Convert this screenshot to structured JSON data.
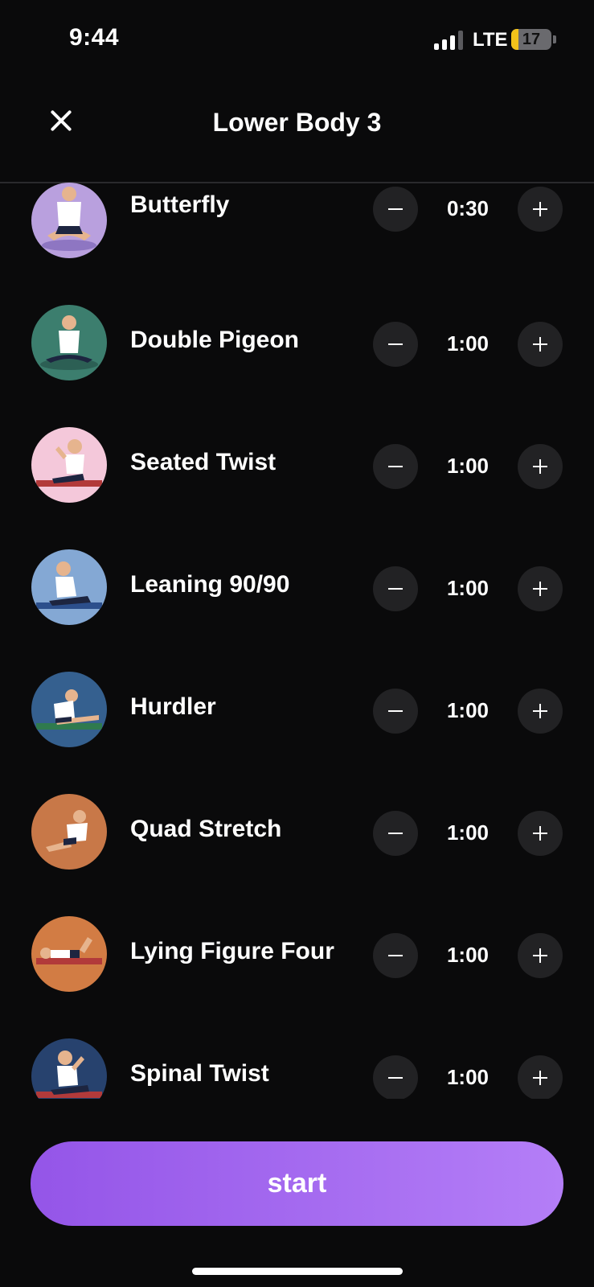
{
  "status_bar": {
    "time": "9:44",
    "network": "LTE",
    "battery_level": "17",
    "battery_color": "#f2c21a"
  },
  "header": {
    "title": "Lower Body 3",
    "close_icon": "close-icon"
  },
  "exercises": [
    {
      "name": "Butterfly",
      "duration": "0:30",
      "avatar_bg": "#b9a0de"
    },
    {
      "name": "Double Pigeon",
      "duration": "1:00",
      "avatar_bg": "#3c7e6e"
    },
    {
      "name": "Seated Twist",
      "duration": "1:00",
      "avatar_bg": "#f4c8da"
    },
    {
      "name": "Leaning 90/90",
      "duration": "1:00",
      "avatar_bg": "#84a8d4"
    },
    {
      "name": "Hurdler",
      "duration": "1:00",
      "avatar_bg": "#35608f"
    },
    {
      "name": "Quad Stretch",
      "duration": "1:00",
      "avatar_bg": "#c87848"
    },
    {
      "name": "Lying Figure Four",
      "duration": "1:00",
      "avatar_bg": "#d27c44"
    },
    {
      "name": "Spinal Twist",
      "duration": "1:00",
      "avatar_bg": "#27426e"
    }
  ],
  "controls": {
    "minus_icon": "minus-icon",
    "plus_icon": "plus-icon"
  },
  "start_button": {
    "label": "start",
    "gradient_start": "#9455e8",
    "gradient_end": "#b47ef7"
  }
}
